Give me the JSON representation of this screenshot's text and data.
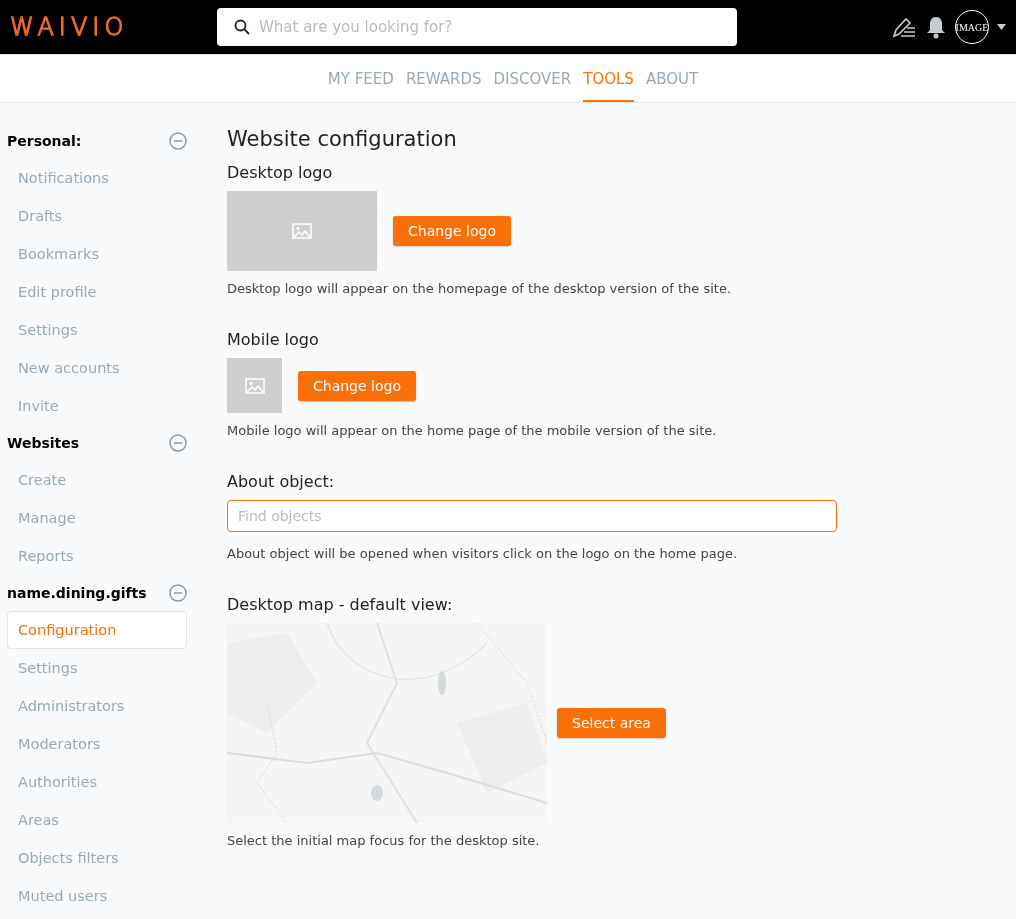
{
  "header": {
    "logo": "WAIVIO",
    "search": {
      "placeholder": "What are you looking for?"
    },
    "avatar": "IMAGE"
  },
  "nav": [
    {
      "label": "MY FEED",
      "selected": false
    },
    {
      "label": "REWARDS",
      "selected": false
    },
    {
      "label": "DISCOVER",
      "selected": false
    },
    {
      "label": "TOOLS",
      "selected": true
    },
    {
      "label": "ABOUT",
      "selected": false
    }
  ],
  "sidebar": {
    "groups": [
      {
        "title": "Personal:",
        "expanded": true,
        "items": [
          {
            "label": "Notifications",
            "selected": false
          },
          {
            "label": "Drafts",
            "selected": false
          },
          {
            "label": "Bookmarks",
            "selected": false
          },
          {
            "label": "Edit profile",
            "selected": false
          },
          {
            "label": "Settings",
            "selected": false
          },
          {
            "label": "New accounts",
            "selected": false
          },
          {
            "label": "Invite",
            "selected": false
          }
        ]
      },
      {
        "title": "Websites",
        "expanded": true,
        "items": [
          {
            "label": "Create",
            "selected": false
          },
          {
            "label": "Manage",
            "selected": false
          },
          {
            "label": "Reports",
            "selected": false
          }
        ]
      },
      {
        "title": "name.dining.gifts",
        "expanded": true,
        "items": [
          {
            "label": "Configuration",
            "selected": true
          },
          {
            "label": "Settings",
            "selected": false
          },
          {
            "label": "Administrators",
            "selected": false
          },
          {
            "label": "Moderators",
            "selected": false
          },
          {
            "label": "Authorities",
            "selected": false
          },
          {
            "label": "Areas",
            "selected": false
          },
          {
            "label": "Objects filters",
            "selected": false
          },
          {
            "label": "Muted users",
            "selected": false
          }
        ]
      }
    ]
  },
  "main": {
    "title": "Website configuration",
    "sections": [
      {
        "kind": "logo",
        "heading": "Desktop logo",
        "button": "Change logo",
        "note": "Desktop logo will appear on the homepage of the desktop version of the site."
      },
      {
        "kind": "icon",
        "heading": "Mobile logo",
        "button": "Change logo",
        "note": "Mobile logo will appear on the home page of the mobile version of the site."
      },
      {
        "kind": "search",
        "heading": "About object:",
        "placeholder": "Find objects",
        "note": "About object will be opened when visitors click on the logo on the home page."
      },
      {
        "kind": "map",
        "heading": "Desktop map - default view:",
        "button": "Select area",
        "note": "Select the initial map focus for the desktop site."
      }
    ]
  }
}
